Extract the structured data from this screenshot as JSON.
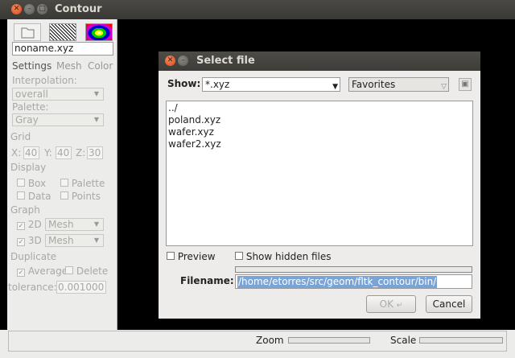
{
  "main_window": {
    "title": "Contour",
    "filename": "noname.xyz",
    "tabs": [
      "Settings",
      "Mesh",
      "Color"
    ],
    "interpolation": {
      "label": "Interpolation:",
      "value": "overall"
    },
    "palette": {
      "label": "Palette:",
      "value": "Gray"
    },
    "grid": {
      "label": "Grid",
      "x_label": "X:",
      "x": "40",
      "y_label": "Y:",
      "y": "40",
      "z_label": "Z:",
      "z": "30"
    },
    "display": {
      "label": "Display",
      "box": "Box",
      "palette": "Palette",
      "data": "Data",
      "points": "Points"
    },
    "graph": {
      "label": "Graph",
      "twod": "2D",
      "twod_value": "Mesh",
      "threed": "3D",
      "threed_value": "Mesh"
    },
    "duplicate": {
      "label": "Duplicate",
      "average": "Average",
      "delete": "Delete"
    },
    "tolerance": {
      "label": "tolerance:",
      "value": "0.001000"
    },
    "bottom": {
      "zoom": "Zoom",
      "scale": "Scale"
    }
  },
  "dialog": {
    "title": "Select file",
    "show_label": "Show:",
    "show_value": "*.xyz",
    "favorites": "Favorites",
    "files": [
      "../",
      "poland.xyz",
      "wafer.xyz",
      "wafer2.xyz"
    ],
    "preview": "Preview",
    "show_hidden": "Show hidden files",
    "filename_label": "Filename:",
    "filename_value": "/home/etorres/src/geom/fltk_contour/bin/",
    "ok": "OK",
    "cancel": "Cancel"
  },
  "colors": {
    "accent_close": "#e05a26",
    "selection": "#7aa4d6",
    "canvas": "#000000"
  }
}
